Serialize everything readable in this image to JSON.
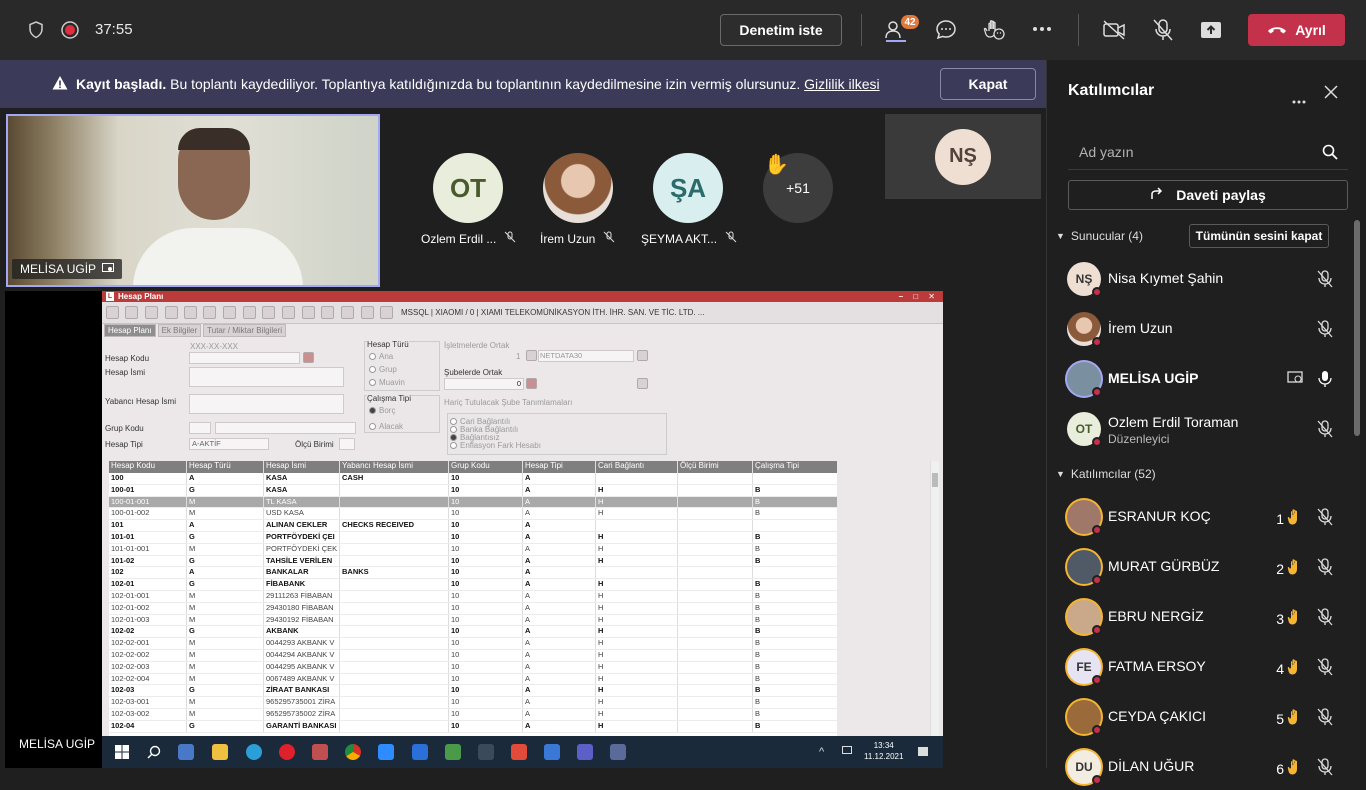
{
  "topbar": {
    "timer": "37:55",
    "denetim_label": "Denetim iste",
    "participants_badge": "42",
    "leave_label": "Ayrıl"
  },
  "banner": {
    "title": "Kayıt başladı.",
    "text": "Bu toplantı kaydediliyor. Toplantıya katıldığınızda bu toplantının kaydedilmesine izin vermiş olursunuz.",
    "link": "Gizlilik ilkesi",
    "close_label": "Kapat"
  },
  "stage": {
    "active_speaker_name": "MELİSA UGİP",
    "avatars": [
      {
        "initials": "OT",
        "name": "Ozlem Erdil ...",
        "bg": "#e8eedb",
        "fg": "#4a5a2e"
      },
      {
        "initials": "",
        "name": "İrem Uzun",
        "bg": "#b88a6a",
        "fg": "#fff"
      },
      {
        "initials": "ŞA",
        "name": "ŞEYMA AKT...",
        "bg": "#d9efef",
        "fg": "#2b6b6b"
      }
    ],
    "overflow_count": "+51",
    "hand_emoji": "✋",
    "ns_initials": "NŞ",
    "shared_name": "MELİSA UGİP"
  },
  "erp": {
    "window_title": "Hesap Planı",
    "connection": "MSSQL | XIAOMI / 0 | XIAMI TELEKOMÜNİKASYON İTH. İHR. SAN. VE TİC. LTD. ...",
    "tabs": [
      "Hesap Planı",
      "Ek Bilgiler",
      "Tutar / Miktar Bilgileri"
    ],
    "code_mask": "XXX-XX-XXX",
    "labels": {
      "hesap_kodu": "Hesap Kodu",
      "hesap_ismi": "Hesap İsmi",
      "yabanci": "Yabancı Hesap İsmi",
      "grup_kodu": "Grup Kodu",
      "hesap_tipi": "Hesap Tipi",
      "hesap_tipi_val": "A-AKTİF",
      "olcu": "Ölçü Birimi",
      "hesap_turu": "Hesap Türü",
      "ana": "Ana",
      "grup": "Grup",
      "muavin": "Muavin",
      "calisma_tipi": "Çalışma Tipi",
      "borc": "Borç",
      "alacak": "Alacak",
      "isletmelerde": "İşletmelerde Ortak",
      "isletme_val": "1",
      "netdata": "NETDATA30",
      "subelerde": "Şubelerde Ortak",
      "sube_val": "0",
      "haric": "Hariç Tutulacak Şube Tanımlamaları",
      "cari": "Cari Bağlantılı",
      "banka": "Banka Bağlantılı",
      "baglantisiz": "Bağlantısız",
      "enflasyon": "Enflasyon Fark Hesabı"
    },
    "columns": [
      "Hesap Kodu",
      "Hesap Türü",
      "Hesap İsmi",
      "Yabancı Hesap İsmi",
      "Grup Kodu",
      "Hesap Tipi",
      "Cari Bağlantı",
      "Ölçü Birimi",
      "Çalışma Tipi"
    ],
    "rows": [
      {
        "kod": "100",
        "tur": "A",
        "isim": "KASA",
        "yab": "CASH",
        "grup": "10",
        "tip": "A",
        "cari": "",
        "olcu": "",
        "cal": "",
        "bold": true
      },
      {
        "kod": "100-01",
        "tur": "G",
        "isim": "KASA",
        "yab": "",
        "grup": "10",
        "tip": "A",
        "cari": "H",
        "olcu": "",
        "cal": "B",
        "bold": true
      },
      {
        "kod": "100-01-001",
        "tur": "M",
        "isim": "TL KASA",
        "yab": "",
        "grup": "10",
        "tip": "A",
        "cari": "H",
        "olcu": "",
        "cal": "B",
        "sel": true
      },
      {
        "kod": "100-01-002",
        "tur": "M",
        "isim": "USD KASA",
        "yab": "",
        "grup": "10",
        "tip": "A",
        "cari": "H",
        "olcu": "",
        "cal": "B"
      },
      {
        "kod": "101",
        "tur": "A",
        "isim": "ALINAN CEKLER",
        "yab": "CHECKS RECEIVED",
        "grup": "10",
        "tip": "A",
        "cari": "",
        "olcu": "",
        "cal": "",
        "bold": true
      },
      {
        "kod": "101-01",
        "tur": "G",
        "isim": "PORTFÖYDEKİ ÇEI",
        "yab": "",
        "grup": "10",
        "tip": "A",
        "cari": "H",
        "olcu": "",
        "cal": "B",
        "bold": true
      },
      {
        "kod": "101-01-001",
        "tur": "M",
        "isim": "PORTFÖYDEKİ ÇEK",
        "yab": "",
        "grup": "10",
        "tip": "A",
        "cari": "H",
        "olcu": "",
        "cal": "B"
      },
      {
        "kod": "101-02",
        "tur": "G",
        "isim": "TAHSİLE VERİLEN",
        "yab": "",
        "grup": "10",
        "tip": "A",
        "cari": "H",
        "olcu": "",
        "cal": "B",
        "bold": true
      },
      {
        "kod": "102",
        "tur": "A",
        "isim": "BANKALAR",
        "yab": "BANKS",
        "grup": "10",
        "tip": "A",
        "cari": "",
        "olcu": "",
        "cal": "",
        "bold": true
      },
      {
        "kod": "102-01",
        "tur": "G",
        "isim": "FİBABANK",
        "yab": "",
        "grup": "10",
        "tip": "A",
        "cari": "H",
        "olcu": "",
        "cal": "B",
        "bold": true
      },
      {
        "kod": "102-01-001",
        "tur": "M",
        "isim": "29111263 FİBABAN",
        "yab": "",
        "grup": "10",
        "tip": "A",
        "cari": "H",
        "olcu": "",
        "cal": "B"
      },
      {
        "kod": "102-01-002",
        "tur": "M",
        "isim": "29430180 FİBABAN",
        "yab": "",
        "grup": "10",
        "tip": "A",
        "cari": "H",
        "olcu": "",
        "cal": "B"
      },
      {
        "kod": "102-01-003",
        "tur": "M",
        "isim": "29430192 FİBABAN",
        "yab": "",
        "grup": "10",
        "tip": "A",
        "cari": "H",
        "olcu": "",
        "cal": "B"
      },
      {
        "kod": "102-02",
        "tur": "G",
        "isim": "AKBANK",
        "yab": "",
        "grup": "10",
        "tip": "A",
        "cari": "H",
        "olcu": "",
        "cal": "B",
        "bold": true
      },
      {
        "kod": "102-02-001",
        "tur": "M",
        "isim": "0044293 AKBANK V",
        "yab": "",
        "grup": "10",
        "tip": "A",
        "cari": "H",
        "olcu": "",
        "cal": "B"
      },
      {
        "kod": "102-02-002",
        "tur": "M",
        "isim": "0044294 AKBANK V",
        "yab": "",
        "grup": "10",
        "tip": "A",
        "cari": "H",
        "olcu": "",
        "cal": "B"
      },
      {
        "kod": "102-02-003",
        "tur": "M",
        "isim": "0044295 AKBANK V",
        "yab": "",
        "grup": "10",
        "tip": "A",
        "cari": "H",
        "olcu": "",
        "cal": "B"
      },
      {
        "kod": "102-02-004",
        "tur": "M",
        "isim": "0067489 AKBANK V",
        "yab": "",
        "grup": "10",
        "tip": "A",
        "cari": "H",
        "olcu": "",
        "cal": "B"
      },
      {
        "kod": "102-03",
        "tur": "G",
        "isim": "ZİRAAT BANKASI",
        "yab": "",
        "grup": "10",
        "tip": "A",
        "cari": "H",
        "olcu": "",
        "cal": "B",
        "bold": true
      },
      {
        "kod": "102-03-001",
        "tur": "M",
        "isim": "965295735001 ZİRA",
        "yab": "",
        "grup": "10",
        "tip": "A",
        "cari": "H",
        "olcu": "",
        "cal": "B"
      },
      {
        "kod": "102-03-002",
        "tur": "M",
        "isim": "965295735002 ZİRA",
        "yab": "",
        "grup": "10",
        "tip": "A",
        "cari": "H",
        "olcu": "",
        "cal": "B"
      },
      {
        "kod": "102-04",
        "tur": "G",
        "isim": "GARANTİ BANKASI",
        "yab": "",
        "grup": "10",
        "tip": "A",
        "cari": "H",
        "olcu": "",
        "cal": "B",
        "bold": true
      }
    ],
    "clock_time": "13:34",
    "clock_date": "11.12.2021"
  },
  "panel": {
    "title": "Katılımcılar",
    "search_placeholder": "Ad yazın",
    "invite_label": "Daveti paylaş",
    "presenters_header": "Sunucular (4)",
    "mute_all_label": "Tümünün sesini kapat",
    "attendees_header": "Katılımcılar (52)",
    "presenters": [
      {
        "initials": "NŞ",
        "name": "Nisa Kıymet Şahin",
        "sub": "",
        "bg": "#efdfd3",
        "bold": false
      },
      {
        "initials": "",
        "name": "İrem Uzun",
        "sub": "",
        "bg": "#b88a6a",
        "bold": false
      },
      {
        "initials": "",
        "name": "MELİSA UGİP",
        "sub": "",
        "bg": "#7a8fa0",
        "bold": true
      },
      {
        "initials": "OT",
        "name": "Ozlem Erdil Toraman",
        "sub": "Düzenleyici",
        "bg": "#e8eedb",
        "bold": false
      }
    ],
    "attendees": [
      {
        "initials": "",
        "name": "ESRANUR KOÇ",
        "hand": "1",
        "bg": "#a0786a"
      },
      {
        "initials": "",
        "name": "MURAT GÜRBÜZ",
        "hand": "2",
        "bg": "#505a66"
      },
      {
        "initials": "",
        "name": "EBRU NERGİZ",
        "hand": "3",
        "bg": "#c9a98a"
      },
      {
        "initials": "FE",
        "name": "FATMA ERSOY",
        "hand": "4",
        "bg": "#e6e3f3"
      },
      {
        "initials": "",
        "name": "CEYDA ÇAKICI",
        "hand": "5",
        "bg": "#9a6a3a"
      },
      {
        "initials": "DU",
        "name": "DİLAN UĞUR",
        "hand": "6",
        "bg": "#f3ece0"
      }
    ]
  }
}
